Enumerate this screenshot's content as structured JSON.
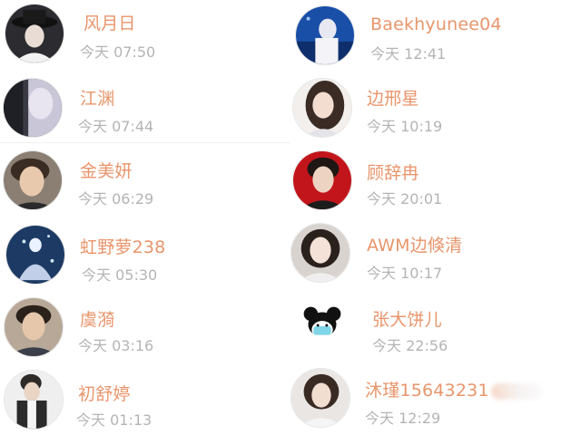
{
  "contacts_left": [
    {
      "name": "风月日",
      "time": "今天 07:50"
    },
    {
      "name": "江渊",
      "time": "今天 07:44"
    },
    {
      "name": "金美妍",
      "time": "今天 06:29"
    },
    {
      "name": "虹野萝238",
      "time": "今天 05:30"
    },
    {
      "name": "虞漪",
      "time": "今天 03:16"
    },
    {
      "name": "初舒婷",
      "time": "今天 01:13"
    }
  ],
  "contacts_right": [
    {
      "name": "Baekhyunee04",
      "time": "今天 12:41"
    },
    {
      "name": "边邢星",
      "time": "今天 10:19"
    },
    {
      "name": "顾辞冉",
      "time": "今天 20:01"
    },
    {
      "name": "AWM边倏清",
      "time": "今天 10:17"
    },
    {
      "name": "张大饼儿",
      "time": "今天 22:56"
    },
    {
      "name": "沐瑾15643231",
      "time": "今天 12:29"
    }
  ],
  "colors": {
    "name": "#e8956b",
    "time": "#b4b4b4"
  }
}
